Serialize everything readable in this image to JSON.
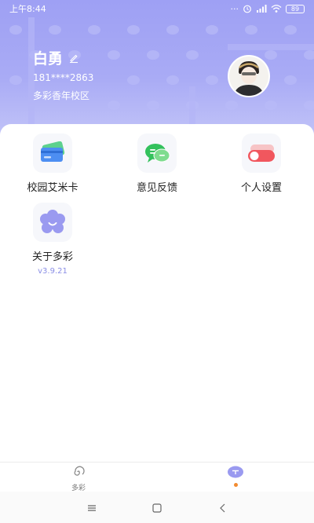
{
  "status_bar": {
    "time": "上午8:44",
    "battery": "89"
  },
  "profile": {
    "name": "白勇",
    "phone": "181****2863",
    "campus": "多彩香年校区"
  },
  "menu": [
    {
      "label": "校园艾米卡",
      "icon": "card-icon"
    },
    {
      "label": "意见反馈",
      "icon": "chat-icon"
    },
    {
      "label": "个人设置",
      "icon": "toggle-icon"
    },
    {
      "label": "关于多彩",
      "icon": "flower-icon",
      "version": "v3.9.21"
    }
  ],
  "tabbar": {
    "tabs": [
      {
        "label": "多彩",
        "icon": "swirl-icon"
      },
      {
        "label": "",
        "icon": "profile-icon",
        "active": true
      }
    ]
  },
  "colors": {
    "header": "#9ea0f4",
    "accent": "#8a8ee6",
    "dot": "#f28b30"
  }
}
